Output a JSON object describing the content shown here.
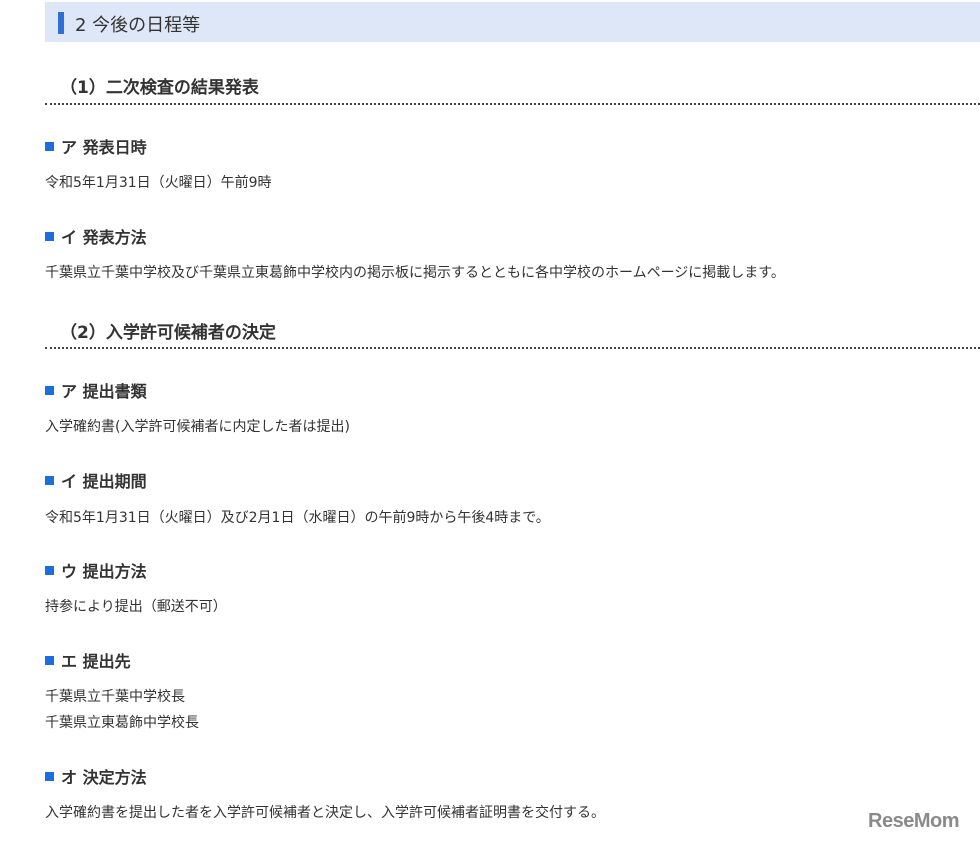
{
  "section_title": "2 今後の日程等",
  "subsections": [
    {
      "title": "（1）二次検査の結果発表",
      "items": [
        {
          "title": "ア 発表日時",
          "lines": [
            "令和5年1月31日（火曜日）午前9時"
          ]
        },
        {
          "title": "イ 発表方法",
          "lines": [
            "千葉県立千葉中学校及び千葉県立東葛飾中学校内の掲示板に掲示するとともに各中学校のホームページに掲載します。"
          ]
        }
      ]
    },
    {
      "title": "（2）入学許可候補者の決定",
      "items": [
        {
          "title": "ア 提出書類",
          "lines": [
            "入学確約書(入学許可候補者に内定した者は提出)"
          ]
        },
        {
          "title": "イ 提出期間",
          "lines": [
            "令和5年1月31日（火曜日）及び2月1日（水曜日）の午前9時から午後4時まで。"
          ]
        },
        {
          "title": "ウ 提出方法",
          "lines": [
            "持参により提出（郵送不可）"
          ]
        },
        {
          "title": "エ 提出先",
          "lines": [
            "千葉県立千葉中学校長",
            "千葉県立東葛飾中学校長"
          ]
        },
        {
          "title": "オ 決定方法",
          "lines": [
            "入学確約書を提出した者を入学許可候補者と決定し、入学許可候補者証明書を交付する。"
          ]
        }
      ]
    }
  ],
  "watermark": "ReseMom"
}
